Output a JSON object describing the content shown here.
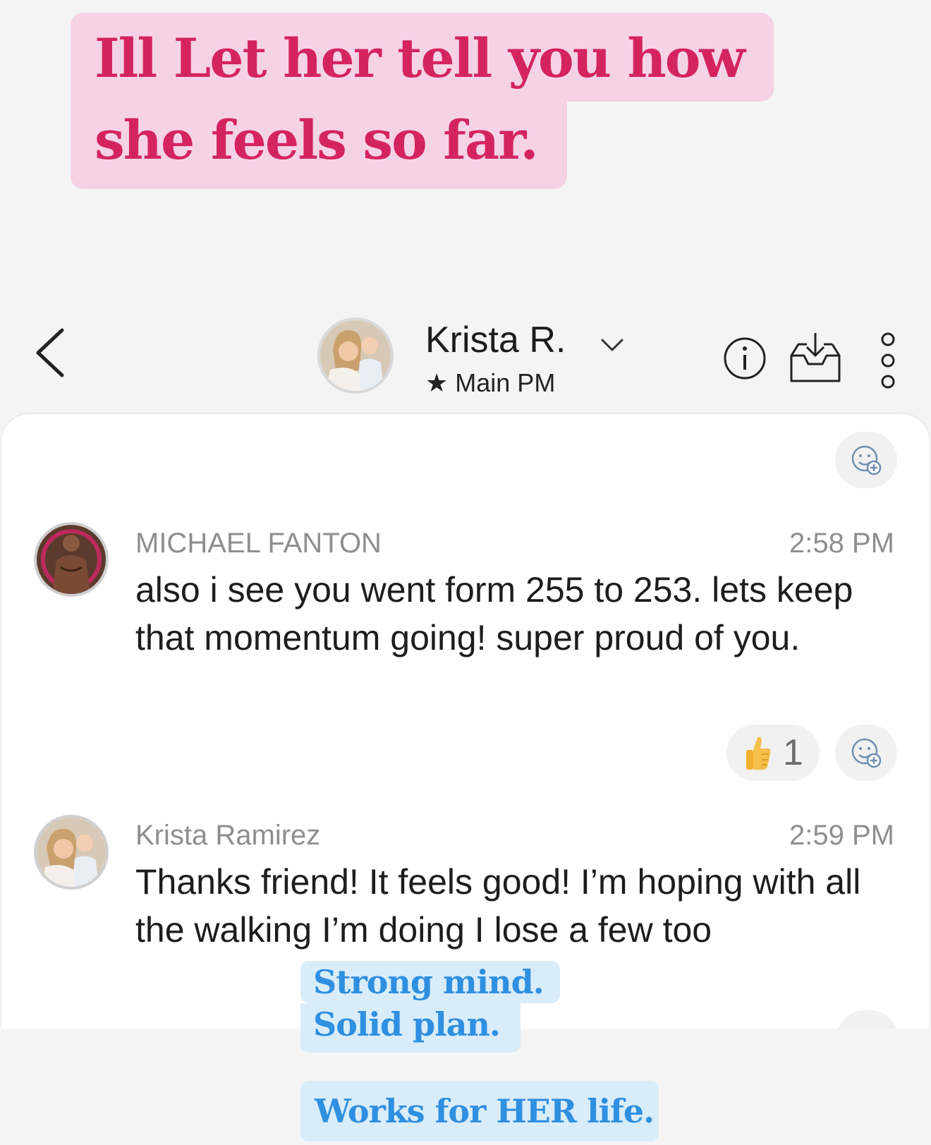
{
  "overlay": {
    "caption_line1": "Ill Let her tell you how",
    "caption_line2": "she feels so far.",
    "tag_line1": "Strong mind.",
    "tag_line2": "Solid plan.",
    "tag_line3": "Works for HER life.",
    "caption_color": "#d4245f",
    "tag_color": "#2f8fe0"
  },
  "header": {
    "contact_name": "Krista R.",
    "contact_subtitle": "★ Main PM",
    "icons": [
      "back-chevron-icon",
      "info-icon",
      "inbox-download-icon",
      "more-vertical-icon",
      "chevron-down-icon"
    ]
  },
  "messages": [
    {
      "sender": "MICHAEL FANTON",
      "time": "2:58 PM",
      "text": "also i see you went form 255 to 253.  lets keep that momentum going! super proud of you.",
      "reactions": [
        {
          "emoji": "thumbs-up-icon",
          "count": "1"
        }
      ]
    },
    {
      "sender": "Krista Ramirez",
      "time": "2:59 PM",
      "text": "Thanks friend! It feels good! I’m hoping with all the walking I’m doing I lose a few too"
    }
  ]
}
